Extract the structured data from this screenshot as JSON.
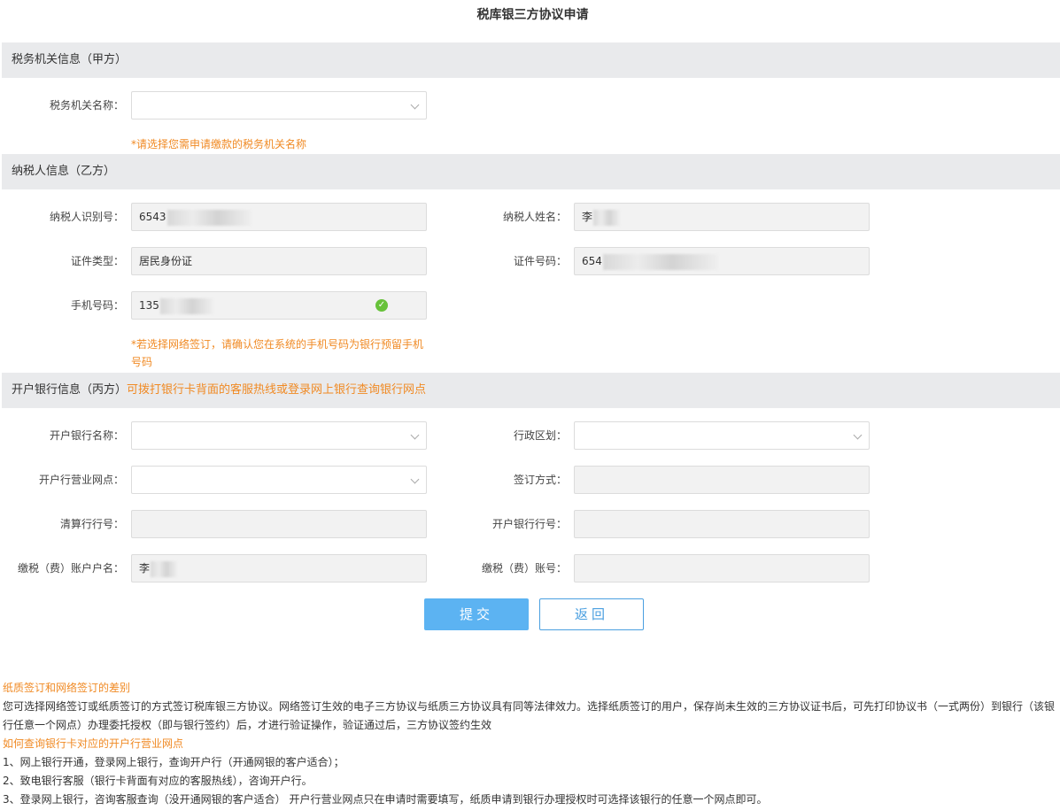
{
  "page_title": "税库银三方协议申请",
  "section_a": {
    "title": "税务机关信息（甲方）"
  },
  "tax_authority": {
    "label": "税务机关名称：",
    "value": "",
    "hint": "*请选择您需申请缴款的税务机关名称"
  },
  "section_b": {
    "title": "纳税人信息（乙方）"
  },
  "taxpayer": {
    "id_label": "纳税人识别号：",
    "id_value": "6543",
    "name_label": "纳税人姓名：",
    "name_value": "李",
    "cert_type_label": "证件类型：",
    "cert_type_value": "居民身份证",
    "cert_no_label": "证件号码：",
    "cert_no_value": "654",
    "phone_label": "手机号码：",
    "phone_value": "135",
    "phone_hint": "*若选择网络签订，请确认您在系统的手机号码为银行预留手机号码"
  },
  "section_c": {
    "title": "开户银行信息（丙方）",
    "note": "可拨打银行卡背面的客服热线或登录网上银行查询银行网点"
  },
  "bank": {
    "bank_name_label": "开户银行名称：",
    "region_label": "行政区划：",
    "branch_label": "开户行营业网点：",
    "sign_method_label": "签订方式：",
    "clearing_label": "清算行行号：",
    "bank_code_label": "开户银行行号：",
    "account_name_label": "缴税（费）账户户名：",
    "account_name_value": "李",
    "account_no_label": "缴税（费）账号："
  },
  "buttons": {
    "submit": "提交",
    "back": "返回"
  },
  "notes": {
    "heading1": "纸质签订和网络签订的差别",
    "para1": "您可选择网络签订或纸质签订的方式签订税库银三方协议。网络签订生效的电子三方协议与纸质三方协议具有同等法律效力。选择纸质签订的用户，保存尚未生效的三方协议证书后，可先打印协议书（一式两份）到银行（该银行任意一个网点）办理委托授权（即与银行签约）后，才进行验证操作，验证通过后，三方协议签约生效",
    "heading2": "如何查询银行卡对应的开户行营业网点",
    "item1": "1、网上银行开通，登录网上银行，查询开户行（开通网银的客户适合）；",
    "item2": "2、致电银行客服（银行卡背面有对应的客服热线），咨询开户行。",
    "item3": "3、登录网上银行，咨询客服查询（没开通网银的客户适合） 开户行营业网点只在申请时需要填写，纸质申请到银行办理授权时可选择该银行的任意一个网点即可。"
  },
  "colors": {
    "accent_orange": "#f08a24",
    "primary_blue": "#5cb3f2",
    "section_bg": "#e9eaec",
    "valid_green": "#67c23a"
  }
}
